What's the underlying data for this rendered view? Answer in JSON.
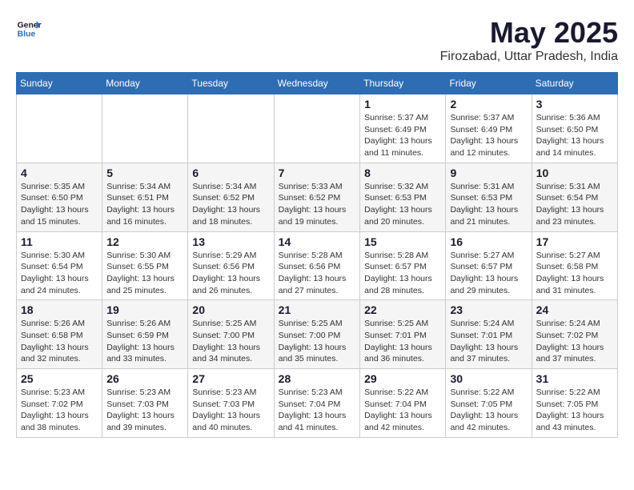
{
  "header": {
    "logo_line1": "General",
    "logo_line2": "Blue",
    "month": "May 2025",
    "location": "Firozabad, Uttar Pradesh, India"
  },
  "weekdays": [
    "Sunday",
    "Monday",
    "Tuesday",
    "Wednesday",
    "Thursday",
    "Friday",
    "Saturday"
  ],
  "weeks": [
    [
      {
        "day": "",
        "info": ""
      },
      {
        "day": "",
        "info": ""
      },
      {
        "day": "",
        "info": ""
      },
      {
        "day": "",
        "info": ""
      },
      {
        "day": "1",
        "info": "Sunrise: 5:37 AM\nSunset: 6:49 PM\nDaylight: 13 hours\nand 11 minutes."
      },
      {
        "day": "2",
        "info": "Sunrise: 5:37 AM\nSunset: 6:49 PM\nDaylight: 13 hours\nand 12 minutes."
      },
      {
        "day": "3",
        "info": "Sunrise: 5:36 AM\nSunset: 6:50 PM\nDaylight: 13 hours\nand 14 minutes."
      }
    ],
    [
      {
        "day": "4",
        "info": "Sunrise: 5:35 AM\nSunset: 6:50 PM\nDaylight: 13 hours\nand 15 minutes."
      },
      {
        "day": "5",
        "info": "Sunrise: 5:34 AM\nSunset: 6:51 PM\nDaylight: 13 hours\nand 16 minutes."
      },
      {
        "day": "6",
        "info": "Sunrise: 5:34 AM\nSunset: 6:52 PM\nDaylight: 13 hours\nand 18 minutes."
      },
      {
        "day": "7",
        "info": "Sunrise: 5:33 AM\nSunset: 6:52 PM\nDaylight: 13 hours\nand 19 minutes."
      },
      {
        "day": "8",
        "info": "Sunrise: 5:32 AM\nSunset: 6:53 PM\nDaylight: 13 hours\nand 20 minutes."
      },
      {
        "day": "9",
        "info": "Sunrise: 5:31 AM\nSunset: 6:53 PM\nDaylight: 13 hours\nand 21 minutes."
      },
      {
        "day": "10",
        "info": "Sunrise: 5:31 AM\nSunset: 6:54 PM\nDaylight: 13 hours\nand 23 minutes."
      }
    ],
    [
      {
        "day": "11",
        "info": "Sunrise: 5:30 AM\nSunset: 6:54 PM\nDaylight: 13 hours\nand 24 minutes."
      },
      {
        "day": "12",
        "info": "Sunrise: 5:30 AM\nSunset: 6:55 PM\nDaylight: 13 hours\nand 25 minutes."
      },
      {
        "day": "13",
        "info": "Sunrise: 5:29 AM\nSunset: 6:56 PM\nDaylight: 13 hours\nand 26 minutes."
      },
      {
        "day": "14",
        "info": "Sunrise: 5:28 AM\nSunset: 6:56 PM\nDaylight: 13 hours\nand 27 minutes."
      },
      {
        "day": "15",
        "info": "Sunrise: 5:28 AM\nSunset: 6:57 PM\nDaylight: 13 hours\nand 28 minutes."
      },
      {
        "day": "16",
        "info": "Sunrise: 5:27 AM\nSunset: 6:57 PM\nDaylight: 13 hours\nand 29 minutes."
      },
      {
        "day": "17",
        "info": "Sunrise: 5:27 AM\nSunset: 6:58 PM\nDaylight: 13 hours\nand 31 minutes."
      }
    ],
    [
      {
        "day": "18",
        "info": "Sunrise: 5:26 AM\nSunset: 6:58 PM\nDaylight: 13 hours\nand 32 minutes."
      },
      {
        "day": "19",
        "info": "Sunrise: 5:26 AM\nSunset: 6:59 PM\nDaylight: 13 hours\nand 33 minutes."
      },
      {
        "day": "20",
        "info": "Sunrise: 5:25 AM\nSunset: 7:00 PM\nDaylight: 13 hours\nand 34 minutes."
      },
      {
        "day": "21",
        "info": "Sunrise: 5:25 AM\nSunset: 7:00 PM\nDaylight: 13 hours\nand 35 minutes."
      },
      {
        "day": "22",
        "info": "Sunrise: 5:25 AM\nSunset: 7:01 PM\nDaylight: 13 hours\nand 36 minutes."
      },
      {
        "day": "23",
        "info": "Sunrise: 5:24 AM\nSunset: 7:01 PM\nDaylight: 13 hours\nand 37 minutes."
      },
      {
        "day": "24",
        "info": "Sunrise: 5:24 AM\nSunset: 7:02 PM\nDaylight: 13 hours\nand 37 minutes."
      }
    ],
    [
      {
        "day": "25",
        "info": "Sunrise: 5:23 AM\nSunset: 7:02 PM\nDaylight: 13 hours\nand 38 minutes."
      },
      {
        "day": "26",
        "info": "Sunrise: 5:23 AM\nSunset: 7:03 PM\nDaylight: 13 hours\nand 39 minutes."
      },
      {
        "day": "27",
        "info": "Sunrise: 5:23 AM\nSunset: 7:03 PM\nDaylight: 13 hours\nand 40 minutes."
      },
      {
        "day": "28",
        "info": "Sunrise: 5:23 AM\nSunset: 7:04 PM\nDaylight: 13 hours\nand 41 minutes."
      },
      {
        "day": "29",
        "info": "Sunrise: 5:22 AM\nSunset: 7:04 PM\nDaylight: 13 hours\nand 42 minutes."
      },
      {
        "day": "30",
        "info": "Sunrise: 5:22 AM\nSunset: 7:05 PM\nDaylight: 13 hours\nand 42 minutes."
      },
      {
        "day": "31",
        "info": "Sunrise: 5:22 AM\nSunset: 7:05 PM\nDaylight: 13 hours\nand 43 minutes."
      }
    ]
  ]
}
